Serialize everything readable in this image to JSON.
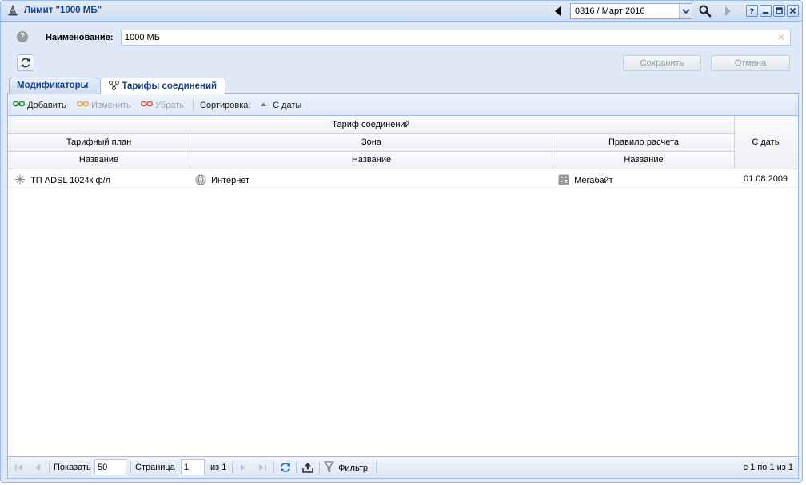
{
  "window": {
    "title": "Лимит \"1000 МБ\"",
    "period": "0316 / Март 2016"
  },
  "form": {
    "name_label": "Наименование:",
    "name_value": "1000 МБ",
    "save_label": "Сохранить",
    "cancel_label": "Отмена"
  },
  "tabs": [
    {
      "label": "Модификаторы",
      "active": false
    },
    {
      "label": "Тарифы соединений",
      "active": true
    }
  ],
  "toolbar": {
    "add": "Добавить",
    "edit": "Изменить",
    "remove": "Убрать",
    "sort_label": "Сортировка:",
    "sort_field": "С даты"
  },
  "grid": {
    "group_header": "Тариф соединений",
    "plan_header": "Тарифный план",
    "zone_header": "Зона",
    "rule_header": "Правило расчета",
    "name_sub": "Название",
    "date_header": "С даты",
    "rows": [
      {
        "plan": "ТП ADSL 1024к ф/л",
        "zone": "Интернет",
        "rule": "Мегабайт",
        "date": "01.08.2009"
      }
    ]
  },
  "pager": {
    "show_label": "Показать",
    "page_size": "50",
    "page_label": "Страница",
    "page": "1",
    "of_label": "из 1",
    "filter_label": "Фильтр",
    "summary": "с 1 по 1 из 1"
  },
  "colors": {
    "accent": "#15428b",
    "border": "#99bbe8",
    "background": "#dfe8f6"
  }
}
